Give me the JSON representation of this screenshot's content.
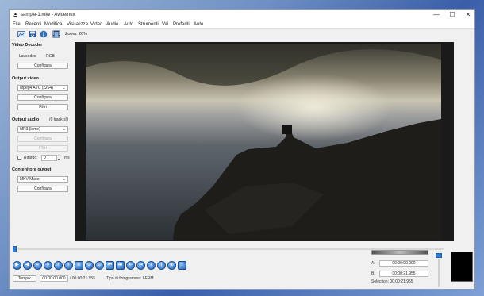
{
  "window": {
    "title": "sample-1.mkv - Avidemux",
    "controls": {
      "minimize": "—",
      "maximize": "☐",
      "close": "✕"
    }
  },
  "menu": [
    "File",
    "Recenti",
    "Modifica",
    "Visualizza",
    "Video",
    "Audio",
    "Auto",
    "Strumenti",
    "Vai",
    "Preferiti",
    "Auto"
  ],
  "toolbar": {
    "icons": [
      "open-video-icon",
      "save-video-icon",
      "info-icon",
      "film-properties-icon"
    ],
    "zoom_label": "Zoom: 26%"
  },
  "sidebar": {
    "video_decoder": {
      "title": "Video Decoder",
      "lavcodec": "Lavcodec",
      "rgb": "RGB",
      "configure": "Configura"
    },
    "video_output": {
      "title": "Output video",
      "codec": "Mpeg4 AVC (x264)",
      "configure": "Configura",
      "filters": "Filtri"
    },
    "audio_output": {
      "title": "Output audio",
      "tracks": "(0 track(s))",
      "codec": "MP3 (lame)",
      "configure": "Configura",
      "filters": "Filtri",
      "delay_label": "Ritardo:",
      "delay_value": "0",
      "delay_unit": "ms"
    },
    "container": {
      "title": "Contenitore output",
      "format": "MKV Muxer",
      "configure": "Configura"
    }
  },
  "playback": {
    "buttons": [
      "play-icon",
      "rewind-icon",
      "step-back-icon",
      "step-forward-icon",
      "prev-keyframe-icon",
      "next-keyframe-icon",
      "waveform-icon",
      "mark-a-icon",
      "mark-b-icon",
      "prev-black-icon",
      "next-black-icon",
      "goto-start-icon",
      "goto-end-icon",
      "prev-cut-icon",
      "next-cut-icon",
      "zoom-icon",
      "mute-icon"
    ],
    "time_button": "Tempo:",
    "current_time": "00:00:00.000",
    "total_time": "/ 00:00:21.955",
    "frame_type": "Tipo di fotogramma: I-FRM"
  },
  "selection": {
    "a_label": "A:",
    "a_value": "00:00:00.000",
    "b_label": "B:",
    "b_value": "00:00:21.955",
    "summary": "Selection: 00:00:21.955"
  }
}
